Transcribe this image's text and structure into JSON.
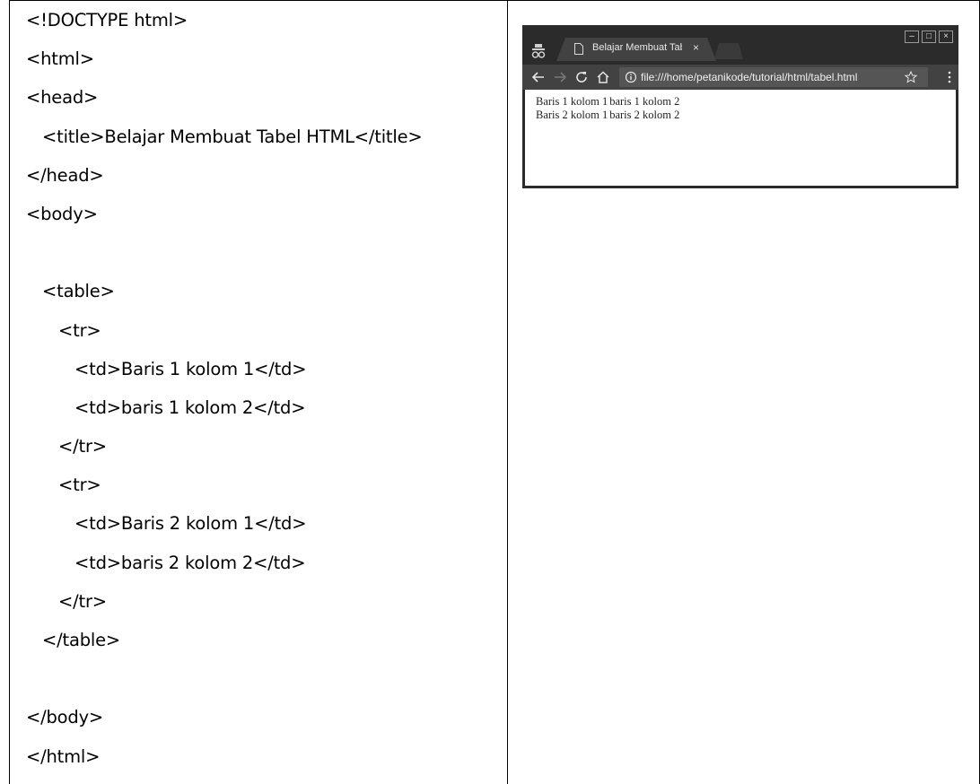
{
  "code": {
    "lines": [
      "<!DOCTYPE html>",
      "<html>",
      "<head>",
      "   <title>Belajar Membuat Tabel HTML</title>",
      "</head>",
      "<body>",
      "",
      "   <table>",
      "      <tr>",
      "         <td>Baris 1 kolom 1</td>",
      "         <td>baris 1 kolom 2</td>",
      "      </tr>",
      "      <tr>",
      "         <td>Baris 2 kolom 1</td>",
      "         <td>baris 2 kolom 2</td>",
      "      </tr>",
      "   </table>",
      "",
      "</body>",
      "</html>"
    ]
  },
  "browser": {
    "tab_title": "Belajar Membuat Tabel",
    "tab_close": "×",
    "url": "file:///home/petanikode/tutorial/html/tabel.html",
    "window_buttons": [
      "–",
      "□",
      "×"
    ],
    "icons": [
      "incognito-icon",
      "page-icon",
      "back-arrow-icon",
      "forward-arrow-icon",
      "reload-icon",
      "home-icon",
      "info-icon",
      "star-icon",
      "menu-icon"
    ],
    "colors": {
      "frame": "#2b2b2b",
      "toolbar": "#424242",
      "omnibox": "#555555"
    },
    "page_table": [
      [
        "Baris 1 kolom 1",
        "baris 1 kolom 2"
      ],
      [
        "Baris 2 kolom 1",
        "baris 2 kolom 2"
      ]
    ]
  }
}
